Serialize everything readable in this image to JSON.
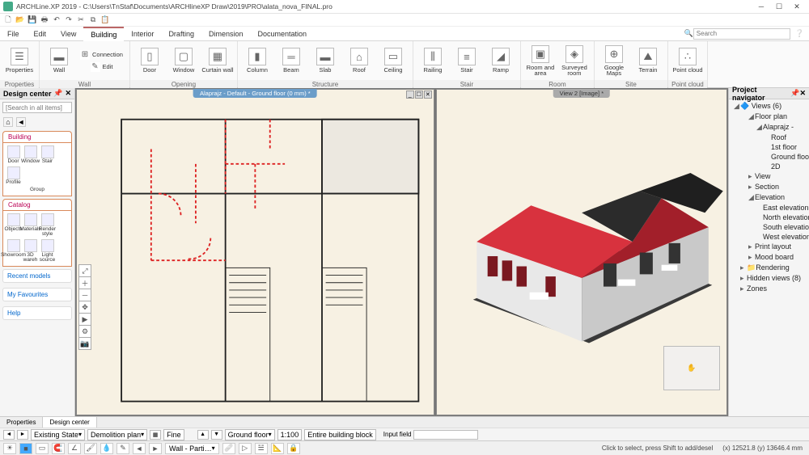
{
  "titlebar": {
    "title": "ARCHLine.XP 2019 - C:\\Users\\TnStaf\\Documents\\ARCHlineXP Draw\\2019\\PRO\\alata_nova_FINAL.pro"
  },
  "menubar": {
    "items": [
      "File",
      "Edit",
      "View",
      "Building",
      "Interior",
      "Drafting",
      "Dimension",
      "Documentation"
    ],
    "active": "Building",
    "search_placeholder": "Search"
  },
  "ribbon": {
    "groups": [
      {
        "label": "Properties",
        "items": [
          {
            "lbl": "Properties",
            "ico": "☰"
          }
        ]
      },
      {
        "label": "Wall",
        "items": [
          {
            "lbl": "Wall",
            "ico": "▬"
          }
        ],
        "side": [
          {
            "lbl": "Connection",
            "ico": "⊞"
          },
          {
            "lbl": "Edit",
            "ico": "✎"
          }
        ]
      },
      {
        "label": "Opening",
        "items": [
          {
            "lbl": "Door",
            "ico": "▯"
          },
          {
            "lbl": "Window",
            "ico": "▢"
          },
          {
            "lbl": "Curtain wall",
            "ico": "▦"
          }
        ]
      },
      {
        "label": "Structure",
        "items": [
          {
            "lbl": "Column",
            "ico": "▮"
          },
          {
            "lbl": "Beam",
            "ico": "═"
          },
          {
            "lbl": "Slab",
            "ico": "▬"
          },
          {
            "lbl": "Roof",
            "ico": "⌂"
          },
          {
            "lbl": "Ceiling",
            "ico": "▭"
          }
        ]
      },
      {
        "label": "Stair",
        "items": [
          {
            "lbl": "Railing",
            "ico": "⫼"
          },
          {
            "lbl": "Stair",
            "ico": "≡"
          },
          {
            "lbl": "Ramp",
            "ico": "◢"
          }
        ]
      },
      {
        "label": "Room",
        "items": [
          {
            "lbl": "Room and area",
            "ico": "▣"
          },
          {
            "lbl": "Surveyed room",
            "ico": "◈"
          }
        ]
      },
      {
        "label": "Site",
        "items": [
          {
            "lbl": "Google Maps",
            "ico": "⊕"
          },
          {
            "lbl": "Terrain",
            "ico": "⛰"
          }
        ]
      },
      {
        "label": "Point cloud",
        "items": [
          {
            "lbl": "Point cloud",
            "ico": "∴"
          }
        ]
      }
    ]
  },
  "design_center": {
    "title": "Design center",
    "search_placeholder": "[Search in all items]",
    "building": {
      "label": "Building",
      "items": [
        {
          "lbl": "Door"
        },
        {
          "lbl": "Window"
        },
        {
          "lbl": "Stair"
        },
        {
          "lbl": "Profile"
        }
      ],
      "group_lbl": "Group"
    },
    "catalog": {
      "label": "Catalog",
      "items": [
        {
          "lbl": "Objects"
        },
        {
          "lbl": "Materials"
        },
        {
          "lbl": "Render style"
        },
        {
          "lbl": "Showroom"
        },
        {
          "lbl": "3D wareh"
        },
        {
          "lbl": "Light source"
        }
      ]
    },
    "links": [
      "Recent models",
      "My Favourites",
      "Help"
    ]
  },
  "views": {
    "left": {
      "title": "Alaprajz - Default - Ground floor (0 mm) *"
    },
    "right": {
      "title": "View 2 [Image] *"
    }
  },
  "navigator": {
    "title": "Project navigator",
    "root": "Views (6)",
    "tree": [
      {
        "lvl": 1,
        "lbl": "Floor plan",
        "exp": true
      },
      {
        "lvl": 2,
        "lbl": "Alaprajz -",
        "exp": true
      },
      {
        "lvl": 3,
        "lbl": "Roof"
      },
      {
        "lvl": 3,
        "lbl": "1st floor"
      },
      {
        "lvl": 3,
        "lbl": "Ground floor"
      },
      {
        "lvl": 3,
        "lbl": "2D"
      },
      {
        "lvl": 1,
        "lbl": "View"
      },
      {
        "lvl": 1,
        "lbl": "Section"
      },
      {
        "lvl": 1,
        "lbl": "Elevation",
        "exp": true
      },
      {
        "lvl": 2,
        "lbl": "East elevation"
      },
      {
        "lvl": 2,
        "lbl": "North elevation"
      },
      {
        "lvl": 2,
        "lbl": "South elevation"
      },
      {
        "lvl": 2,
        "lbl": "West elevation"
      },
      {
        "lvl": 1,
        "lbl": "Print layout"
      },
      {
        "lvl": 1,
        "lbl": "Mood board"
      },
      {
        "lvl": 0,
        "lbl": "Rendering",
        "folder": true
      },
      {
        "lvl": 0,
        "lbl": "Hidden views (8)"
      },
      {
        "lvl": 0,
        "lbl": "Zones"
      }
    ]
  },
  "bottom_tabs": [
    "Properties",
    "Design center"
  ],
  "controls": {
    "existing_state": "Existing State",
    "demolition_plan": "Demolition plan",
    "fine": "Fine",
    "floor": "Ground floor",
    "scale": "1:100",
    "mode": "Entire building block",
    "input_label": "Input field"
  },
  "statusbar": {
    "wall": "Wall - Parti…",
    "hint": "Click to select, press Shift to add/desel",
    "coords": "(x) 12521.8   (y) 13646.4 mm"
  }
}
